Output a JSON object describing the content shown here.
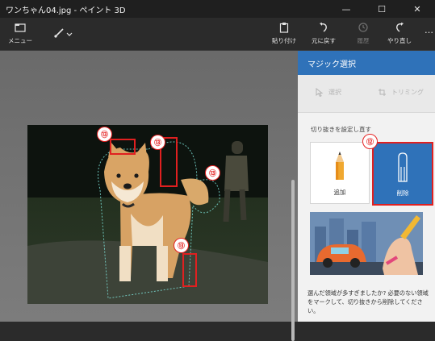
{
  "window": {
    "title": "ワンちゃん04.jpg - ペイント 3D",
    "minimize_icon": "minimize-icon",
    "maximize_icon": "maximize-icon",
    "close_icon": "close-icon"
  },
  "toolbar": {
    "menu_label": "メニュー",
    "paste_label": "貼り付け",
    "undo_label": "元に戻す",
    "history_label": "履歴",
    "redo_label": "やり直し",
    "more_label": "…"
  },
  "panel": {
    "title": "マジック選択",
    "select_label": "選択",
    "trim_label": "トリミング",
    "reset_link": "切り抜きを設定し直す",
    "add_label": "追加",
    "remove_label": "削除",
    "help_text": "選んだ領域が多すぎましたか? 必要のない領域をマークして、切り抜きから削除してください。"
  },
  "annotations": {
    "callout_13": "⑬",
    "callout_12": "⑫"
  },
  "colors": {
    "accent": "#2f72b9",
    "annotation_red": "#e02020"
  }
}
